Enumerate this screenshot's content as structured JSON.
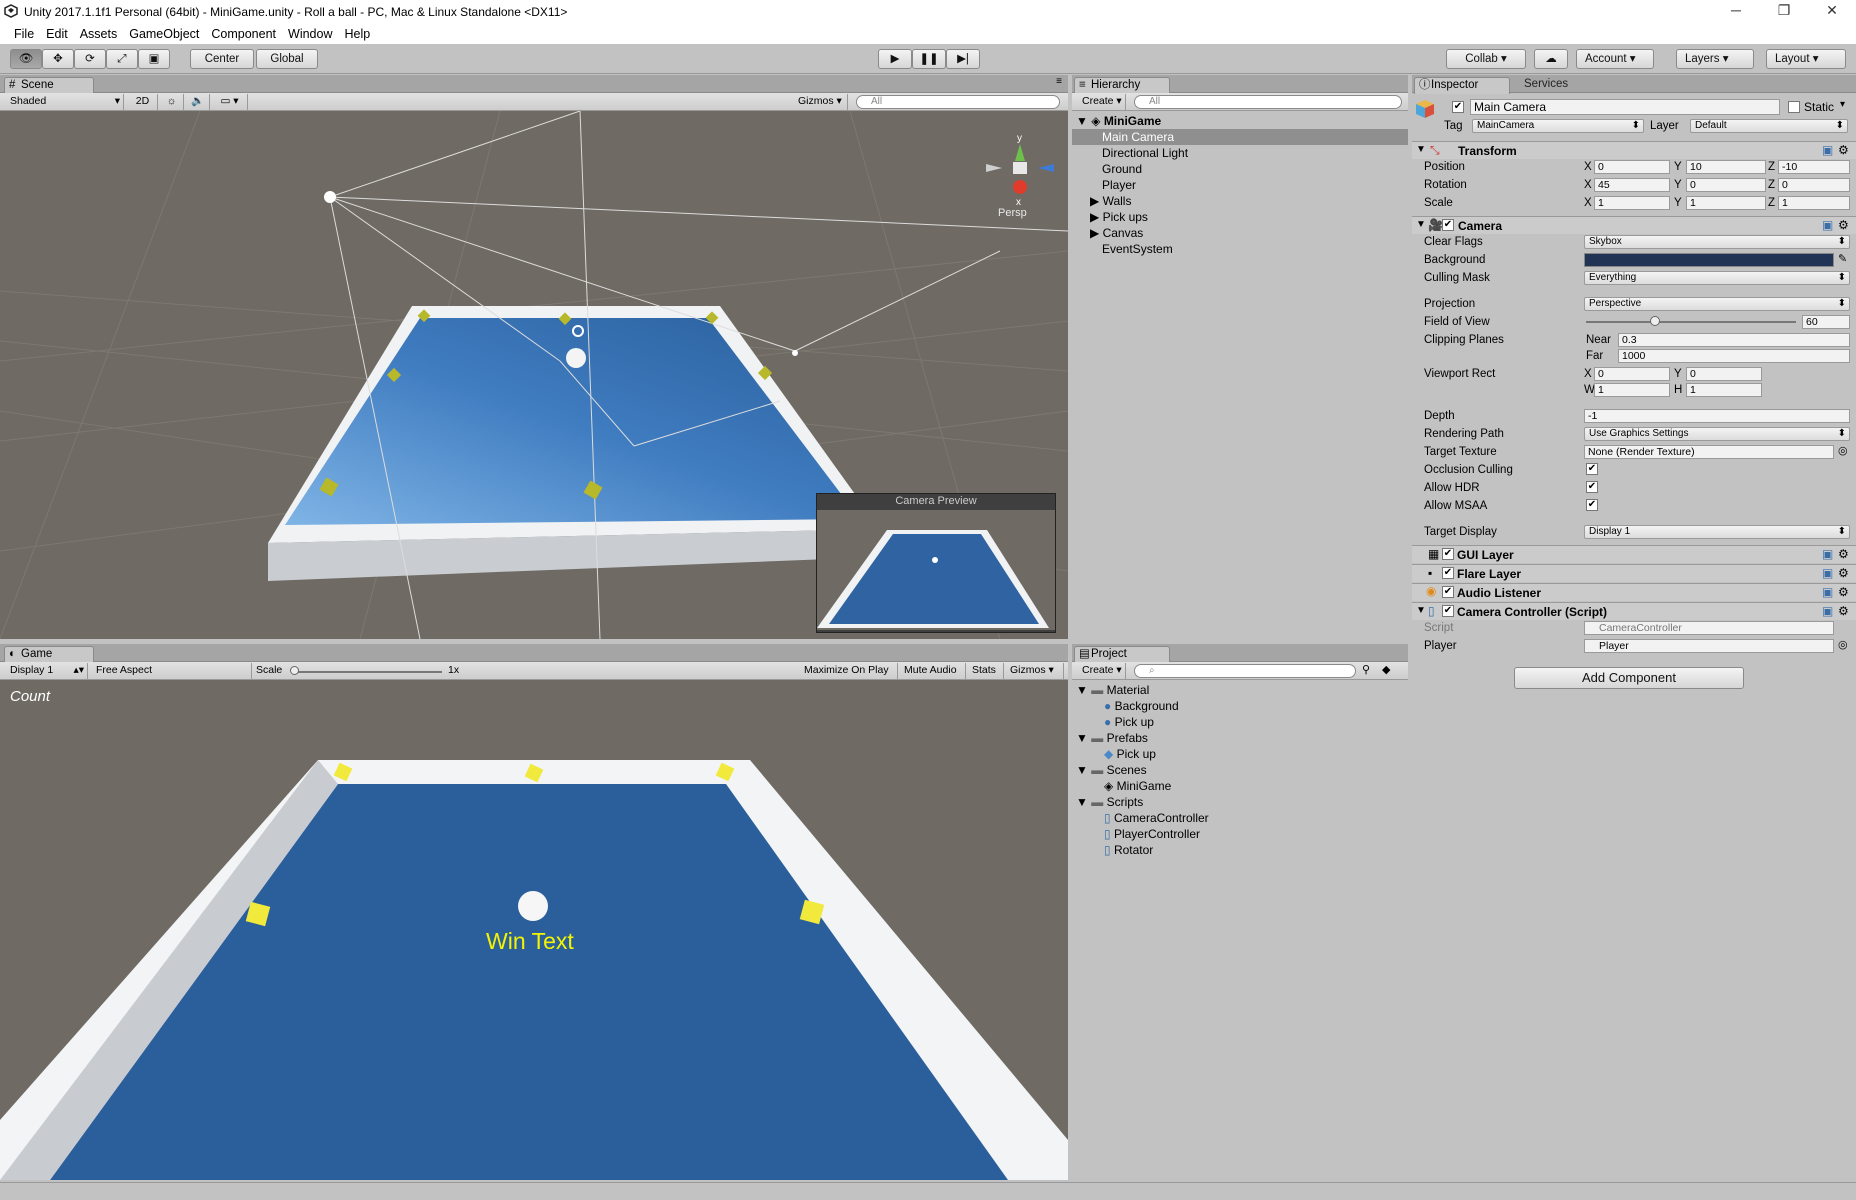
{
  "window": {
    "title": "Unity 2017.1.1f1 Personal (64bit) - MiniGame.unity - Roll a ball - PC, Mac & Linux Standalone <DX11>"
  },
  "menu": [
    "File",
    "Edit",
    "Assets",
    "GameObject",
    "Component",
    "Window",
    "Help"
  ],
  "toolbar": {
    "center": "Center",
    "global": "Global",
    "collab": "Collab ▾",
    "account": "Account",
    "layers": "Layers",
    "layout": "Layout"
  },
  "scene": {
    "tab": "Scene",
    "shading": "Shaded",
    "mode2d": "2D",
    "gizmos": "Gizmos ▾",
    "search": "All",
    "persp": "Persp",
    "axis_y": "y",
    "axis_x": "x",
    "preview_title": "Camera Preview"
  },
  "game": {
    "tab": "Game",
    "display": "Display 1",
    "aspect": "Free Aspect",
    "scale_label": "Scale",
    "scale_value": "1x",
    "maximize": "Maximize On Play",
    "mute": "Mute Audio",
    "stats": "Stats",
    "gizmos": "Gizmos ▾",
    "count_text": "Count",
    "win_text": "Win Text"
  },
  "hierarchy": {
    "tab": "Hierarchy",
    "create": "Create ▾",
    "search": "All",
    "scene_name": "MiniGame",
    "items": [
      {
        "label": "Main Camera",
        "selected": true,
        "expandable": false
      },
      {
        "label": "Directional Light",
        "expandable": false
      },
      {
        "label": "Ground",
        "expandable": false
      },
      {
        "label": "Player",
        "expandable": false
      },
      {
        "label": "Walls",
        "expandable": true
      },
      {
        "label": "Pick ups",
        "expandable": true
      },
      {
        "label": "Canvas",
        "expandable": true
      },
      {
        "label": "EventSystem",
        "expandable": false
      }
    ]
  },
  "project": {
    "tab": "Project",
    "create": "Create ▾",
    "tree": [
      {
        "label": "Material",
        "type": "folder",
        "depth": 0
      },
      {
        "label": "Background",
        "type": "material",
        "depth": 1
      },
      {
        "label": "Pick up",
        "type": "material",
        "depth": 1
      },
      {
        "label": "Prefabs",
        "type": "folder",
        "depth": 0
      },
      {
        "label": "Pick up",
        "type": "prefab",
        "depth": 1
      },
      {
        "label": "Scenes",
        "type": "folder",
        "depth": 0
      },
      {
        "label": "MiniGame",
        "type": "scene",
        "depth": 1
      },
      {
        "label": "Scripts",
        "type": "folder",
        "depth": 0
      },
      {
        "label": "CameraController",
        "type": "script",
        "depth": 1
      },
      {
        "label": "PlayerController",
        "type": "script",
        "depth": 1
      },
      {
        "label": "Rotator",
        "type": "script",
        "depth": 1
      }
    ]
  },
  "inspector": {
    "tab": "Inspector",
    "services_tab": "Services",
    "object_name": "Main Camera",
    "static_label": "Static",
    "tag_label": "Tag",
    "tag_value": "MainCamera",
    "layer_label": "Layer",
    "layer_value": "Default",
    "transform": {
      "title": "Transform",
      "position_label": "Position",
      "rotation_label": "Rotation",
      "scale_label": "Scale",
      "axis_x": "X",
      "axis_y": "Y",
      "axis_z": "Z",
      "position": [
        "0",
        "10",
        "-10"
      ],
      "rotation": [
        "45",
        "0",
        "0"
      ],
      "scale": [
        "1",
        "1",
        "1"
      ]
    },
    "camera": {
      "title": "Camera",
      "clear_flags_label": "Clear Flags",
      "clear_flags": "Skybox",
      "background_label": "Background",
      "background_color": "#223455",
      "culling_mask_label": "Culling Mask",
      "culling_mask": "Everything",
      "projection_label": "Projection",
      "projection": "Perspective",
      "fov_label": "Field of View",
      "fov": "60",
      "fov_fraction": 0.33,
      "clipping_label": "Clipping Planes",
      "near_label": "Near",
      "near": "0.3",
      "far_label": "Far",
      "far": "1000",
      "viewport_label": "Viewport Rect",
      "vp_x_label": "X",
      "vp_y_label": "Y",
      "vp_w_label": "W",
      "vp_h_label": "H",
      "vp_x": "0",
      "vp_y": "0",
      "vp_w": "1",
      "vp_h": "1",
      "depth_label": "Depth",
      "depth": "-1",
      "rendering_path_label": "Rendering Path",
      "rendering_path": "Use Graphics Settings",
      "target_texture_label": "Target Texture",
      "target_texture": "None (Render Texture)",
      "occlusion_label": "Occlusion Culling",
      "hdr_label": "Allow HDR",
      "msaa_label": "Allow MSAA",
      "target_display_label": "Target Display",
      "target_display": "Display 1"
    },
    "components": [
      "GUI Layer",
      "Flare Layer",
      "Audio Listener",
      "Camera Controller (Script)"
    ],
    "script_label": "Script",
    "script_value": "CameraController",
    "player_label": "Player",
    "player_value": "Player",
    "add_component": "Add Component"
  },
  "colors": {
    "accent_blue": "#3d6fa8",
    "selection": "#8f8f8f",
    "panel": "#c2c2c2",
    "scene_bg": "#6f6a63"
  }
}
